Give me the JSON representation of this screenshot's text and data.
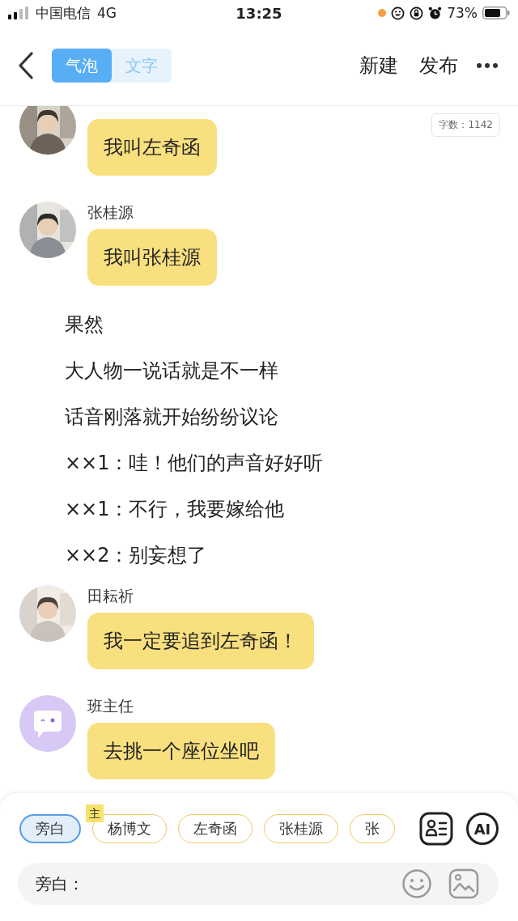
{
  "status_bar": {
    "carrier": "中国电信",
    "network": "4G",
    "time": "13:25",
    "battery": "73%"
  },
  "header": {
    "tabs": [
      {
        "label": "气泡",
        "selected": true
      },
      {
        "label": "文字",
        "selected": false
      }
    ],
    "actions": [
      "新建",
      "发布"
    ]
  },
  "word_count": "字数：1142",
  "messages": [
    {
      "kind": "bubble",
      "text": "我叫左奇函"
    },
    {
      "kind": "bubble",
      "name": "张桂源",
      "text": "我叫张桂源"
    },
    {
      "kind": "narration",
      "text": "果然"
    },
    {
      "kind": "narration",
      "text": "大人物一说话就是不一样"
    },
    {
      "kind": "narration",
      "text": "话音刚落就开始纷纷议论"
    },
    {
      "kind": "narration",
      "text": "××1：哇！他们的声音好好听"
    },
    {
      "kind": "narration",
      "text": "××1：不行，我要嫁给他"
    },
    {
      "kind": "narration",
      "text": "××2：别妄想了"
    },
    {
      "kind": "bubble",
      "name": "田耘祈",
      "text": "我一定要追到左奇函！"
    },
    {
      "kind": "bubble",
      "avatar": {
        "kind": "chat"
      },
      "name": "班主任",
      "text": "去挑一个座位坐吧"
    }
  ],
  "ai_button": "AI",
  "roles": [
    {
      "label": "旁白",
      "selected": true
    },
    {
      "label": "杨博文",
      "selected": false,
      "badge": "主"
    },
    {
      "label": "左奇函",
      "selected": false
    },
    {
      "label": "张桂源",
      "selected": false
    },
    {
      "label": "张",
      "selected": false
    }
  ],
  "input": {
    "prefix": "旁白："
  }
}
